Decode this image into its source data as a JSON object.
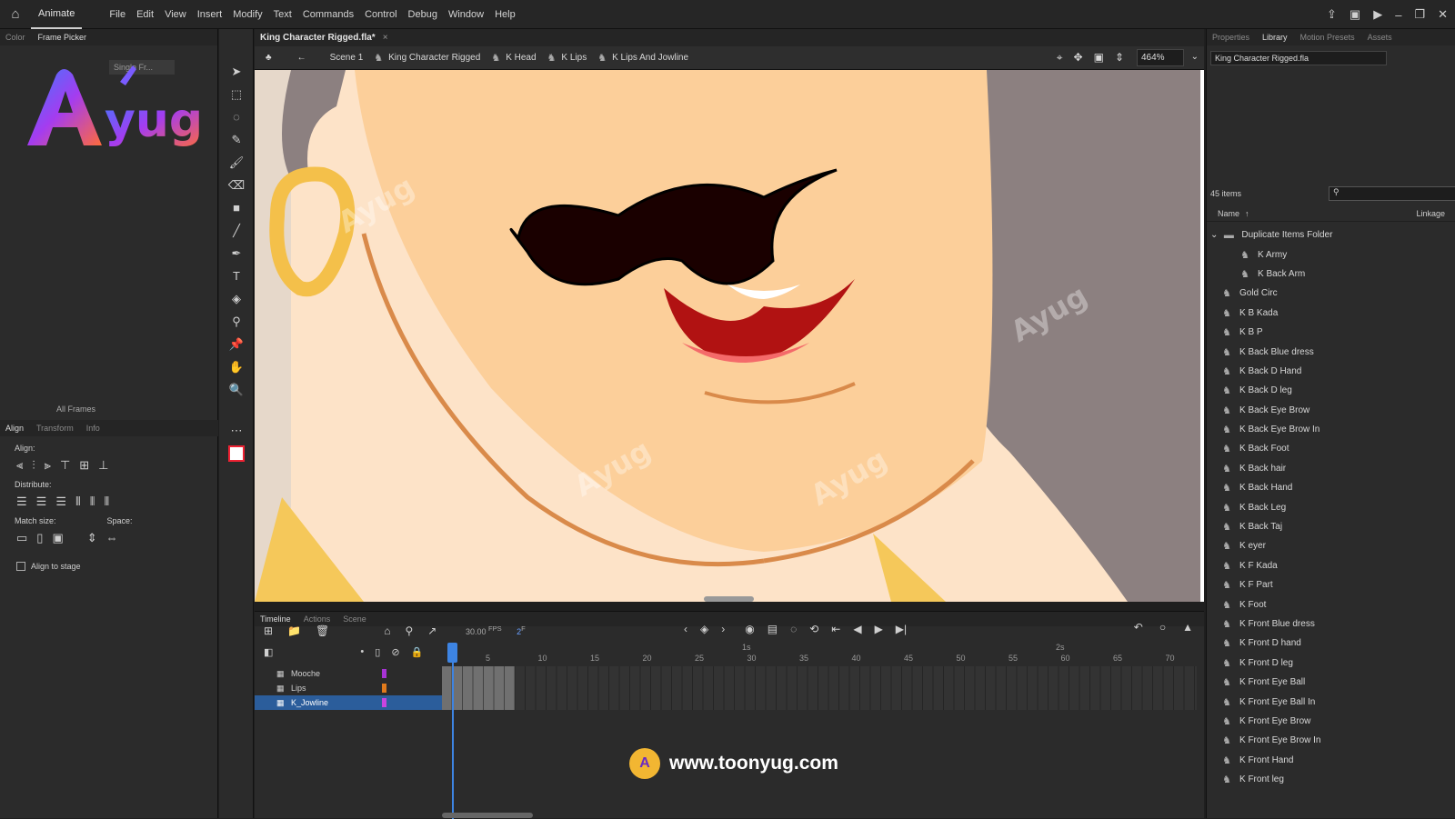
{
  "menubar": {
    "app": "Animate",
    "items": [
      "File",
      "Edit",
      "View",
      "Insert",
      "Modify",
      "Text",
      "Commands",
      "Control",
      "Debug",
      "Window",
      "Help"
    ]
  },
  "left_panel": {
    "tabs": [
      "Color",
      "Frame Picker"
    ],
    "single_frame": "Single Fr...",
    "all_frames": "All Frames",
    "align_tabs": [
      "Align",
      "Transform",
      "Info"
    ],
    "align_label": "Align:",
    "distribute_label": "Distribute:",
    "match_size_label": "Match size:",
    "space_label": "Space:",
    "align_to_stage": "Align to stage"
  },
  "document": {
    "tab": "King Character Rigged.fla*",
    "breadcrumbs": [
      "Scene 1",
      "King Character Rigged",
      "K Head",
      "K Lips",
      "K Lips And Jowline"
    ],
    "zoom": "464%"
  },
  "timeline": {
    "tabs": [
      "Timeline",
      "Actions",
      "Scene"
    ],
    "fps": "30.00",
    "fps_unit": "FPS",
    "frame": "2",
    "frame_unit": "F",
    "ruler": [
      "5",
      "10",
      "15",
      "20",
      "25",
      "30",
      "35",
      "40",
      "45",
      "50",
      "55",
      "60",
      "65",
      "70"
    ],
    "seconds": [
      "1s",
      "2s"
    ],
    "layers": [
      {
        "name": "Mooche",
        "color": "#a833d6",
        "selected": false
      },
      {
        "name": "Lips",
        "color": "#e07a1c",
        "selected": false
      },
      {
        "name": "K_Jowline",
        "color": "#c844e0",
        "selected": true
      }
    ]
  },
  "library": {
    "tabs": [
      "Properties",
      "Library",
      "Motion Presets",
      "Assets"
    ],
    "file": "King Character Rigged.fla",
    "count": "45 items",
    "col_name": "Name",
    "col_linkage": "Linkage",
    "items": [
      {
        "name": "Duplicate Items Folder",
        "type": "folder"
      },
      {
        "name": "K Army",
        "type": "child"
      },
      {
        "name": "K Back Arm",
        "type": "child"
      },
      {
        "name": "Gold Circ",
        "type": "symbol"
      },
      {
        "name": "K B Kada",
        "type": "symbol"
      },
      {
        "name": "K B P",
        "type": "symbol"
      },
      {
        "name": "K Back Blue dress",
        "type": "symbol"
      },
      {
        "name": "K Back D Hand",
        "type": "symbol"
      },
      {
        "name": "K Back D leg",
        "type": "symbol"
      },
      {
        "name": "K Back Eye Brow",
        "type": "symbol"
      },
      {
        "name": "K Back Eye Brow In",
        "type": "symbol"
      },
      {
        "name": "K Back Foot",
        "type": "symbol"
      },
      {
        "name": "K Back hair",
        "type": "symbol"
      },
      {
        "name": "K Back Hand",
        "type": "symbol"
      },
      {
        "name": "K Back Leg",
        "type": "symbol"
      },
      {
        "name": "K Back Taj",
        "type": "symbol"
      },
      {
        "name": "K eyer",
        "type": "symbol"
      },
      {
        "name": "K F Kada",
        "type": "symbol"
      },
      {
        "name": "K F Part",
        "type": "symbol"
      },
      {
        "name": "K Foot",
        "type": "symbol"
      },
      {
        "name": "K Front Blue dress",
        "type": "symbol"
      },
      {
        "name": "K Front D hand",
        "type": "symbol"
      },
      {
        "name": "K Front D leg",
        "type": "symbol"
      },
      {
        "name": "K Front Eye Ball",
        "type": "symbol"
      },
      {
        "name": "K Front Eye Ball In",
        "type": "symbol"
      },
      {
        "name": "K Front Eye Brow",
        "type": "symbol"
      },
      {
        "name": "K Front Eye Brow In",
        "type": "symbol"
      },
      {
        "name": "K Front Hand",
        "type": "symbol"
      },
      {
        "name": "K Front leg",
        "type": "symbol"
      }
    ]
  },
  "branding": {
    "logo": "Ayug",
    "url": "www.toonyug.com",
    "watermark": "Ayug"
  }
}
